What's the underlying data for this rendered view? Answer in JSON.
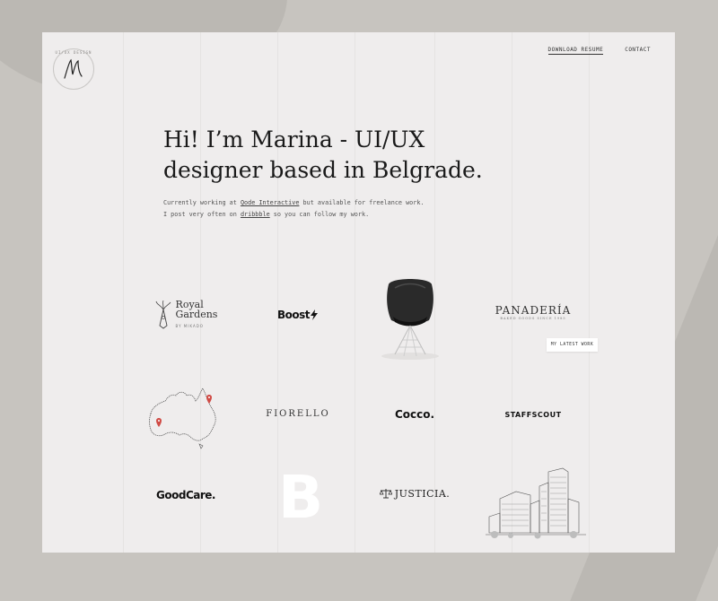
{
  "logo": {
    "ring_text": "UI/UX DESIGN"
  },
  "nav": {
    "download_resume": "DOWNLOAD RESUME",
    "contact": "CONTACT"
  },
  "hero": {
    "title": "Hi! I’m Marina - UI/UX designer based in Belgrade.",
    "line1_prefix": "Currently working at ",
    "line1_link": "Qode Interactive",
    "line1_suffix": " but available for freelance work.",
    "line2_prefix": "I post very often on ",
    "line2_link": "dribbble",
    "line2_suffix": " so you can follow my work."
  },
  "work": {
    "royal_title_1": "Royal",
    "royal_title_2": "Gardens",
    "royal_sub": "BY MIKADO",
    "boost": "Boost",
    "panaderia": "PANADERÍA",
    "panaderia_sub": "BAKED GOODS SINCE 1985",
    "fiorello": "FIORELLO",
    "cocco": "Cocco.",
    "staffscout": "STAFFSCOUT",
    "goodcare": "GoodCare.",
    "bigb": "B",
    "justicia": "JUSTICIA.",
    "latest_work_button": "MY LATEST WORK"
  },
  "colors": {
    "background": "#c7c4bf",
    "page": "#efeded",
    "text": "#1a1a1a",
    "map_pin": "#d04b45"
  }
}
